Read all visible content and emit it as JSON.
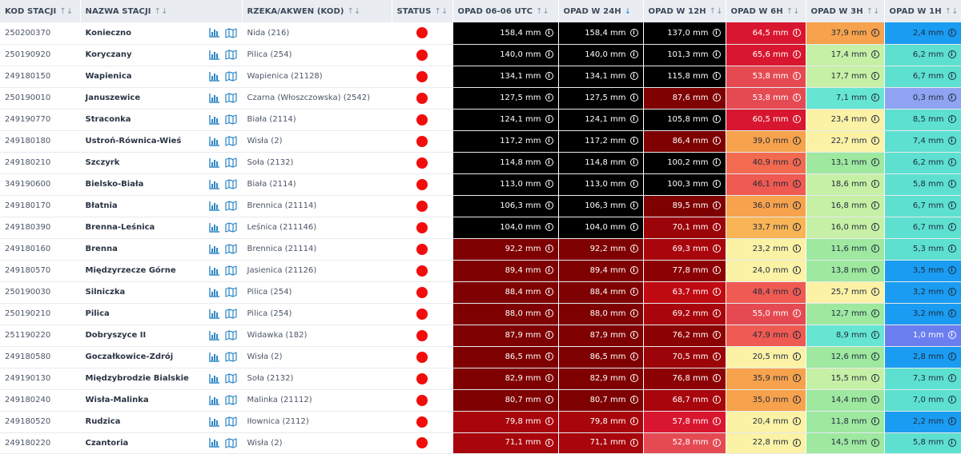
{
  "columns": [
    {
      "label": "KOD STACJI",
      "sort": "both"
    },
    {
      "label": "NAZWA STACJI",
      "sort": "both"
    },
    {
      "label": "RZEKA/AKWEN (KOD)",
      "sort": "both"
    },
    {
      "label": "STATUS",
      "sort": "both"
    },
    {
      "label": "OPAD 06-06 UTC",
      "sort": "both"
    },
    {
      "label": "OPAD W 24H",
      "sort": "desc"
    },
    {
      "label": "OPAD W 12H",
      "sort": "both"
    },
    {
      "label": "OPAD W 6H",
      "sort": "both"
    },
    {
      "label": "OPAD W 3H",
      "sort": "both"
    },
    {
      "label": "OPAD W 1H",
      "sort": "both"
    }
  ],
  "icons": {
    "chart": "bar-chart-icon",
    "map": "map-icon",
    "info": "info-icon",
    "sort": "sort-arrows-icon"
  },
  "status_color": "#f20d0d",
  "unit": "mm",
  "rows": [
    {
      "code": "250200370",
      "name": "Konieczno",
      "river": "Nida (216)",
      "values": [
        "158,4",
        "158,4",
        "137,0",
        "64,5",
        "37,9",
        "2,4"
      ],
      "colors": [
        [
          "#000000",
          "#ffffff"
        ],
        [
          "#000000",
          "#ffffff"
        ],
        [
          "#000000",
          "#ffffff"
        ],
        [
          "#d9162f",
          "#ffffff"
        ],
        [
          "#f7a24d",
          "#1f2a3a"
        ],
        [
          "#1a9cf2",
          "#1f2a3a"
        ]
      ]
    },
    {
      "code": "250190920",
      "name": "Koryczany",
      "river": "Pilica (254)",
      "values": [
        "140,0",
        "140,0",
        "101,3",
        "65,6",
        "17,4",
        "6,2"
      ],
      "colors": [
        [
          "#000000",
          "#ffffff"
        ],
        [
          "#000000",
          "#ffffff"
        ],
        [
          "#000000",
          "#ffffff"
        ],
        [
          "#d9162f",
          "#ffffff"
        ],
        [
          "#c6f0a6",
          "#1f2a3a"
        ],
        [
          "#5de0cf",
          "#1f2a3a"
        ]
      ]
    },
    {
      "code": "249180150",
      "name": "Wapienica",
      "river": "Wapienica (21128)",
      "values": [
        "134,1",
        "134,1",
        "115,8",
        "53,8",
        "17,7",
        "6,7"
      ],
      "colors": [
        [
          "#000000",
          "#ffffff"
        ],
        [
          "#000000",
          "#ffffff"
        ],
        [
          "#000000",
          "#ffffff"
        ],
        [
          "#e54a53",
          "#ffffff"
        ],
        [
          "#c6f0a6",
          "#1f2a3a"
        ],
        [
          "#5de0cf",
          "#1f2a3a"
        ]
      ]
    },
    {
      "code": "250190010",
      "name": "Januszewice",
      "river": "Czarna (Włoszczowska) (2542)",
      "values": [
        "127,5",
        "127,5",
        "87,6",
        "53,8",
        "7,1",
        "0,3"
      ],
      "colors": [
        [
          "#000000",
          "#ffffff"
        ],
        [
          "#000000",
          "#ffffff"
        ],
        [
          "#7e0000",
          "#ffffff"
        ],
        [
          "#e54a53",
          "#ffffff"
        ],
        [
          "#66e6d2",
          "#1f2a3a"
        ],
        [
          "#8ea4f2",
          "#1f2a3a"
        ]
      ]
    },
    {
      "code": "249190770",
      "name": "Straconka",
      "river": "Biała (2114)",
      "values": [
        "124,1",
        "124,1",
        "105,8",
        "60,5",
        "23,4",
        "8,5"
      ],
      "colors": [
        [
          "#000000",
          "#ffffff"
        ],
        [
          "#000000",
          "#ffffff"
        ],
        [
          "#000000",
          "#ffffff"
        ],
        [
          "#d9162f",
          "#ffffff"
        ],
        [
          "#fbf2a6",
          "#1f2a3a"
        ],
        [
          "#5de0cf",
          "#1f2a3a"
        ]
      ]
    },
    {
      "code": "249180180",
      "name": "Ustroń-Równica-Wieś",
      "river": "Wisła (2)",
      "values": [
        "117,2",
        "117,2",
        "86,4",
        "39,0",
        "22,7",
        "7,4"
      ],
      "colors": [
        [
          "#000000",
          "#ffffff"
        ],
        [
          "#000000",
          "#ffffff"
        ],
        [
          "#7e0000",
          "#ffffff"
        ],
        [
          "#f7a24d",
          "#1f2a3a"
        ],
        [
          "#fbf2a6",
          "#1f2a3a"
        ],
        [
          "#5de0cf",
          "#1f2a3a"
        ]
      ]
    },
    {
      "code": "249180210",
      "name": "Szczyrk",
      "river": "Soła (2132)",
      "values": [
        "114,8",
        "114,8",
        "100,2",
        "40,9",
        "13,1",
        "6,2"
      ],
      "colors": [
        [
          "#000000",
          "#ffffff"
        ],
        [
          "#000000",
          "#ffffff"
        ],
        [
          "#000000",
          "#ffffff"
        ],
        [
          "#f26a4f",
          "#1f2a3a"
        ],
        [
          "#9ee8a0",
          "#1f2a3a"
        ],
        [
          "#5de0cf",
          "#1f2a3a"
        ]
      ]
    },
    {
      "code": "349190600",
      "name": "Bielsko-Biała",
      "river": "Biała (2114)",
      "values": [
        "113,0",
        "113,0",
        "100,3",
        "46,1",
        "18,6",
        "5,8"
      ],
      "colors": [
        [
          "#000000",
          "#ffffff"
        ],
        [
          "#000000",
          "#ffffff"
        ],
        [
          "#000000",
          "#ffffff"
        ],
        [
          "#ef5a52",
          "#1f2a3a"
        ],
        [
          "#c6f0a6",
          "#1f2a3a"
        ],
        [
          "#5de0cf",
          "#1f2a3a"
        ]
      ]
    },
    {
      "code": "249180170",
      "name": "Błatnia",
      "river": "Brennica (21114)",
      "values": [
        "106,3",
        "106,3",
        "89,5",
        "36,0",
        "16,8",
        "6,7"
      ],
      "colors": [
        [
          "#000000",
          "#ffffff"
        ],
        [
          "#000000",
          "#ffffff"
        ],
        [
          "#7e0000",
          "#ffffff"
        ],
        [
          "#f7a24d",
          "#1f2a3a"
        ],
        [
          "#c6f0a6",
          "#1f2a3a"
        ],
        [
          "#5de0cf",
          "#1f2a3a"
        ]
      ]
    },
    {
      "code": "249180390",
      "name": "Brenna-Leśnica",
      "river": "Leśnica (211146)",
      "values": [
        "104,0",
        "104,0",
        "70,1",
        "33,7",
        "16,0",
        "6,7"
      ],
      "colors": [
        [
          "#000000",
          "#ffffff"
        ],
        [
          "#000000",
          "#ffffff"
        ],
        [
          "#9b0408",
          "#ffffff"
        ],
        [
          "#f9b456",
          "#1f2a3a"
        ],
        [
          "#c6f0a6",
          "#1f2a3a"
        ],
        [
          "#5de0cf",
          "#1f2a3a"
        ]
      ]
    },
    {
      "code": "249180160",
      "name": "Brenna",
      "river": "Brennica (21114)",
      "values": [
        "92,2",
        "92,2",
        "69,3",
        "23,2",
        "11,6",
        "5,3"
      ],
      "colors": [
        [
          "#7e0000",
          "#ffffff"
        ],
        [
          "#7e0000",
          "#ffffff"
        ],
        [
          "#a8060c",
          "#ffffff"
        ],
        [
          "#fbf2a6",
          "#1f2a3a"
        ],
        [
          "#9ee8a0",
          "#1f2a3a"
        ],
        [
          "#5de0cf",
          "#1f2a3a"
        ]
      ]
    },
    {
      "code": "249180570",
      "name": "Międzyrzecze Górne",
      "river": "Jasienica (21126)",
      "values": [
        "89,4",
        "89,4",
        "77,8",
        "24,0",
        "13,8",
        "3,5"
      ],
      "colors": [
        [
          "#7e0000",
          "#ffffff"
        ],
        [
          "#7e0000",
          "#ffffff"
        ],
        [
          "#8c0204",
          "#ffffff"
        ],
        [
          "#fbf2a6",
          "#1f2a3a"
        ],
        [
          "#9ee8a0",
          "#1f2a3a"
        ],
        [
          "#1a9cf2",
          "#1f2a3a"
        ]
      ]
    },
    {
      "code": "250190030",
      "name": "Silniczka",
      "river": "Pilica (254)",
      "values": [
        "88,4",
        "88,4",
        "63,7",
        "48,4",
        "25,7",
        "3,2"
      ],
      "colors": [
        [
          "#7e0000",
          "#ffffff"
        ],
        [
          "#7e0000",
          "#ffffff"
        ],
        [
          "#c00a12",
          "#ffffff"
        ],
        [
          "#ef5a52",
          "#1f2a3a"
        ],
        [
          "#fbf2a6",
          "#1f2a3a"
        ],
        [
          "#1a9cf2",
          "#1f2a3a"
        ]
      ]
    },
    {
      "code": "250190210",
      "name": "Pilica",
      "river": "Pilica (254)",
      "values": [
        "88,0",
        "88,0",
        "69,2",
        "55,0",
        "12,7",
        "3,2"
      ],
      "colors": [
        [
          "#7e0000",
          "#ffffff"
        ],
        [
          "#7e0000",
          "#ffffff"
        ],
        [
          "#a8060c",
          "#ffffff"
        ],
        [
          "#e54a53",
          "#ffffff"
        ],
        [
          "#9ee8a0",
          "#1f2a3a"
        ],
        [
          "#1a9cf2",
          "#1f2a3a"
        ]
      ]
    },
    {
      "code": "251190220",
      "name": "Dobryszyce II",
      "river": "Widawka (182)",
      "values": [
        "87,9",
        "87,9",
        "76,2",
        "47,9",
        "8,9",
        "1,0"
      ],
      "colors": [
        [
          "#7e0000",
          "#ffffff"
        ],
        [
          "#7e0000",
          "#ffffff"
        ],
        [
          "#8c0204",
          "#ffffff"
        ],
        [
          "#ef5a52",
          "#1f2a3a"
        ],
        [
          "#66e6d2",
          "#1f2a3a"
        ],
        [
          "#6a7ef0",
          "#ffffff"
        ]
      ]
    },
    {
      "code": "249180580",
      "name": "Goczałkowice-Zdrój",
      "river": "Wisła (2)",
      "values": [
        "86,5",
        "86,5",
        "70,5",
        "20,5",
        "12,6",
        "2,8"
      ],
      "colors": [
        [
          "#7e0000",
          "#ffffff"
        ],
        [
          "#7e0000",
          "#ffffff"
        ],
        [
          "#9b0408",
          "#ffffff"
        ],
        [
          "#fbf2a6",
          "#1f2a3a"
        ],
        [
          "#9ee8a0",
          "#1f2a3a"
        ],
        [
          "#1a9cf2",
          "#1f2a3a"
        ]
      ]
    },
    {
      "code": "249190130",
      "name": "Międzybrodzie Bialskie",
      "river": "Soła (2132)",
      "values": [
        "82,9",
        "82,9",
        "76,8",
        "35,9",
        "15,5",
        "7,3"
      ],
      "colors": [
        [
          "#7e0000",
          "#ffffff"
        ],
        [
          "#7e0000",
          "#ffffff"
        ],
        [
          "#8c0204",
          "#ffffff"
        ],
        [
          "#f7a24d",
          "#1f2a3a"
        ],
        [
          "#c6f0a6",
          "#1f2a3a"
        ],
        [
          "#5de0cf",
          "#1f2a3a"
        ]
      ]
    },
    {
      "code": "249180240",
      "name": "Wisła-Malinka",
      "river": "Malinka (21112)",
      "values": [
        "80,7",
        "80,7",
        "68,7",
        "35,0",
        "14,4",
        "7,0"
      ],
      "colors": [
        [
          "#7e0000",
          "#ffffff"
        ],
        [
          "#7e0000",
          "#ffffff"
        ],
        [
          "#a8060c",
          "#ffffff"
        ],
        [
          "#f7a24d",
          "#1f2a3a"
        ],
        [
          "#9ee8a0",
          "#1f2a3a"
        ],
        [
          "#5de0cf",
          "#1f2a3a"
        ]
      ]
    },
    {
      "code": "249180520",
      "name": "Rudzica",
      "river": "Iłownica (2112)",
      "values": [
        "79,8",
        "79,8",
        "57,8",
        "20,4",
        "11,8",
        "2,2"
      ],
      "colors": [
        [
          "#a8060c",
          "#ffffff"
        ],
        [
          "#a8060c",
          "#ffffff"
        ],
        [
          "#d9162f",
          "#ffffff"
        ],
        [
          "#fbf2a6",
          "#1f2a3a"
        ],
        [
          "#9ee8a0",
          "#1f2a3a"
        ],
        [
          "#1a9cf2",
          "#1f2a3a"
        ]
      ]
    },
    {
      "code": "249180220",
      "name": "Czantoria",
      "river": "Wisła (2)",
      "values": [
        "71,1",
        "71,1",
        "52,8",
        "22,8",
        "14,5",
        "5,8"
      ],
      "colors": [
        [
          "#a8060c",
          "#ffffff"
        ],
        [
          "#a8060c",
          "#ffffff"
        ],
        [
          "#e54a53",
          "#ffffff"
        ],
        [
          "#fbf2a6",
          "#1f2a3a"
        ],
        [
          "#9ee8a0",
          "#1f2a3a"
        ],
        [
          "#5de0cf",
          "#1f2a3a"
        ]
      ]
    }
  ]
}
